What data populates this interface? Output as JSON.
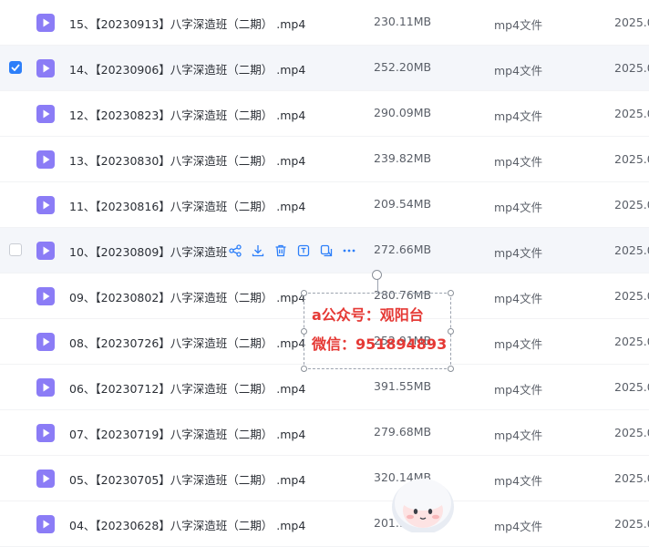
{
  "colors": {
    "accent": "#2d7ff9",
    "file_icon": "#8b7cf6",
    "watermark_text": "#e53935"
  },
  "icons": {
    "file": "video-file-icon",
    "actions": [
      "share-icon",
      "download-icon",
      "delete-icon",
      "rename-icon",
      "copy-icon",
      "more-icon"
    ]
  },
  "rows": [
    {
      "name": "15、【20230913】八字深造班（二期） .mp4",
      "size": "230.11MB",
      "type": "mp4文件",
      "date": "2025.0",
      "state": "normal"
    },
    {
      "name": "14、【20230906】八字深造班（二期） .mp4",
      "size": "252.20MB",
      "type": "mp4文件",
      "date": "2025.0",
      "state": "selected"
    },
    {
      "name": "12、【20230823】八字深造班（二期） .mp4",
      "size": "290.09MB",
      "type": "mp4文件",
      "date": "2025.0",
      "state": "normal"
    },
    {
      "name": "13、【20230830】八字深造班（二期） .mp4",
      "size": "239.82MB",
      "type": "mp4文件",
      "date": "2025.0",
      "state": "normal"
    },
    {
      "name": "11、【20230816】八字深造班（二期） .mp4",
      "size": "209.54MB",
      "type": "mp4文件",
      "date": "2025.0",
      "state": "normal"
    },
    {
      "name": "10、【20230809】八字深造班",
      "size": "272.66MB",
      "type": "mp4文件",
      "date": "2025.0",
      "state": "hovered"
    },
    {
      "name": "09、【20230802】八字深造班（二期） .mp4",
      "size": "280.76MB",
      "type": "mp4文件",
      "date": "2025.0",
      "state": "normal"
    },
    {
      "name": "08、【20230726】八字深造班（二期） .mp4",
      "size": "252.91MB",
      "type": "mp4文件",
      "date": "2025.0",
      "state": "normal"
    },
    {
      "name": "06、【20230712】八字深造班（二期） .mp4",
      "size": "391.55MB",
      "type": "mp4文件",
      "date": "2025.0",
      "state": "normal"
    },
    {
      "name": "07、【20230719】八字深造班（二期） .mp4",
      "size": "279.68MB",
      "type": "mp4文件",
      "date": "2025.0",
      "state": "normal"
    },
    {
      "name": "05、【20230705】八字深造班（二期） .mp4",
      "size": "320.14MB",
      "type": "mp4文件",
      "date": "2025.0",
      "state": "normal"
    },
    {
      "name": "04、【20230628】八字深造班（二期） .mp4",
      "size": "201.9",
      "type": "mp4文件",
      "date": "2025.0",
      "state": "normal"
    }
  ],
  "watermark": {
    "line1": "a公众号：观阳台",
    "line2": "微信：951894893"
  }
}
